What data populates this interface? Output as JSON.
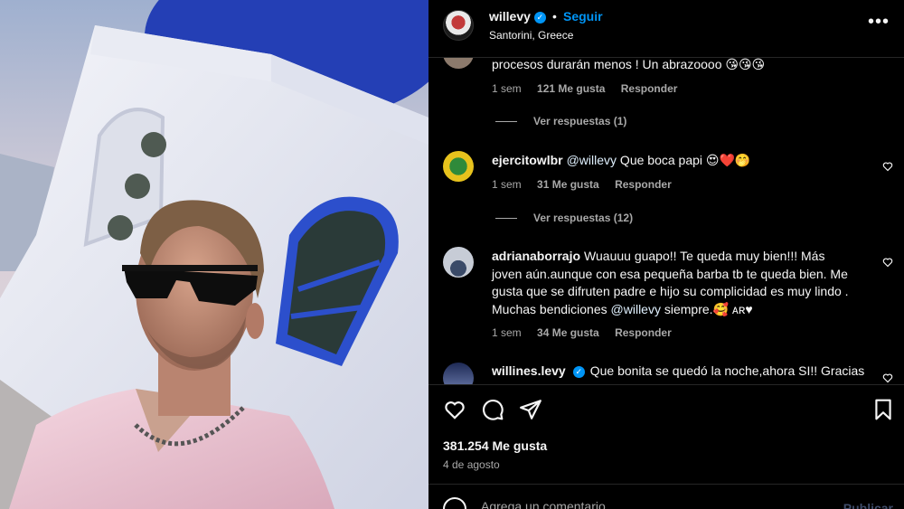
{
  "post": {
    "username": "willevy",
    "separator": "•",
    "follow_label": "Seguir",
    "location": "Santorini, Greece",
    "more_label": "•••"
  },
  "comments": [
    {
      "text": "procesos durarán menos ! Un abrazoooo 😘😘😘",
      "time": "1 sem",
      "likes": "121 Me gusta",
      "reply": "Responder",
      "view_replies": "Ver respuestas (1)"
    },
    {
      "user": "ejercitowlbr",
      "mention": "@willevy",
      "text": " Que boca papi 😍❤️🤭",
      "time": "1 sem",
      "likes": "31 Me gusta",
      "reply": "Responder",
      "view_replies": "Ver respuestas (12)"
    },
    {
      "user": "adrianaborrajo",
      "text_a": "Wuauuu guapo!! Te queda muy bien!!! Más joven aún.aunque con esa pequeña barba tb te queda bien. Me gusta que se difruten padre e hijo su complicidad es muy lindo . Muchas bendiciones ",
      "mention": "@willevy",
      "text_b": " siempre.🥰 ᴀʀ♥",
      "time": "1 sem",
      "likes": "34 Me gusta",
      "reply": "Responder"
    },
    {
      "user": "willines.levy",
      "text": "Que bonita se quedó la noche,ahora SI!! Gracias"
    }
  ],
  "actions": {
    "likes_total": "381.254 Me gusta",
    "date": "4 de agosto"
  },
  "composer": {
    "placeholder": "Agrega un comentario...",
    "publish_label": "Publicar"
  },
  "colors": {
    "accent": "#0095f6",
    "background": "#000000",
    "muted_text": "#a8a8a8"
  }
}
